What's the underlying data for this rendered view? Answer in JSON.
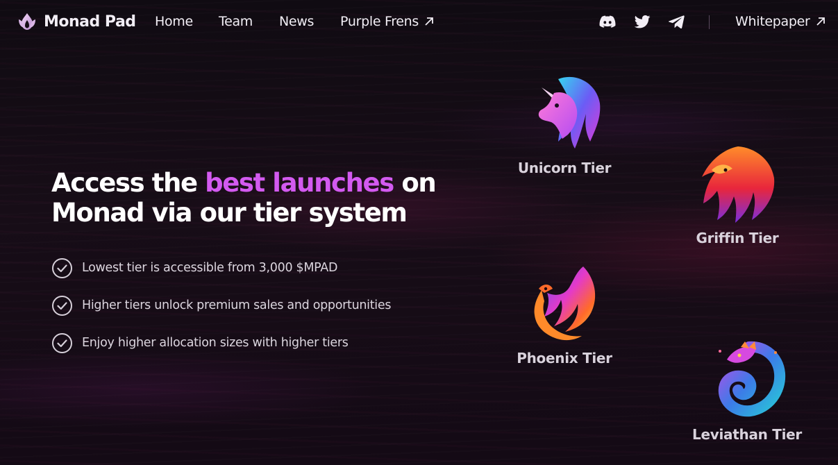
{
  "brand": {
    "name": "Monad Pad",
    "logo_icon": "lotus-flame-logo",
    "colors": {
      "accent": "#d35af0",
      "background": "#140c15",
      "text": "#ffffff"
    }
  },
  "nav": {
    "links": [
      {
        "label": "Home"
      },
      {
        "label": "Team"
      },
      {
        "label": "News"
      },
      {
        "label": "Purple Frens",
        "icon": "arrow-up-right-icon"
      }
    ],
    "social": [
      {
        "icon": "discord-icon"
      },
      {
        "icon": "twitter-icon"
      },
      {
        "icon": "telegram-icon"
      }
    ],
    "whitepaper": {
      "label": "Whitepaper",
      "icon": "arrow-up-right-icon"
    }
  },
  "hero": {
    "headline_before": "Access the ",
    "headline_accent": "best launches",
    "headline_after": " on Monad via our tier system",
    "features": [
      {
        "text": "Lowest tier is accessible from 3,000 $MPAD",
        "icon": "check-circle-icon"
      },
      {
        "text": "Higher tiers unlock premium sales and opportunities",
        "icon": "check-circle-icon"
      },
      {
        "text": "Enjoy higher allocation sizes with higher tiers",
        "icon": "check-circle-icon"
      }
    ]
  },
  "tiers": [
    {
      "label": "Unicorn Tier",
      "icon": "unicorn-icon"
    },
    {
      "label": "Griffin Tier",
      "icon": "griffin-icon"
    },
    {
      "label": "Phoenix Tier",
      "icon": "phoenix-icon"
    },
    {
      "label": "Leviathan Tier",
      "icon": "leviathan-icon"
    }
  ]
}
